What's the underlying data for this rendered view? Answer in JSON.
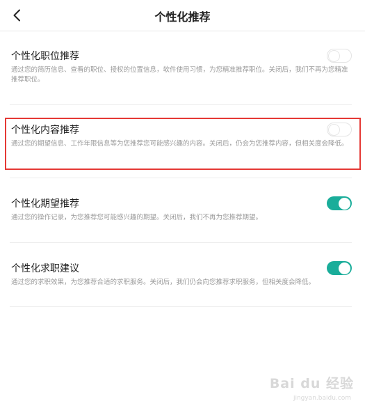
{
  "header": {
    "title": "个性化推荐",
    "back_icon": "chevron-left-icon"
  },
  "items": [
    {
      "title": "个性化职位推荐",
      "desc": "通过您的简历信息、查看的职位、授权的位置信息，软件使用习惯，为您精准推荐职位。关闭后，我们不再为您精准推荐职位。",
      "enabled": false
    },
    {
      "title": "个性化内容推荐",
      "desc": "通过您的期望信息、工作年限信息等为您推荐您可能感兴趣的内容。关闭后，仍会为您推荐内容，但相关度会降低。",
      "enabled": false
    },
    {
      "title": "个性化期望推荐",
      "desc": "通过您的操作记录，为您推荐您可能感兴趣的期望。关闭后，我们不再为您推荐期望。",
      "enabled": true
    },
    {
      "title": "个性化求职建议",
      "desc": "通过您的求职效果，为您推荐合适的求职服务。关闭后，我们仍会向您推荐求职服务，但相关度会降低。",
      "enabled": true
    }
  ],
  "colors": {
    "accent": "#1aad9a",
    "highlight": "#e53935"
  },
  "watermark": {
    "main": "Bai du 经验",
    "sub": "jingyan.baidu.com"
  }
}
